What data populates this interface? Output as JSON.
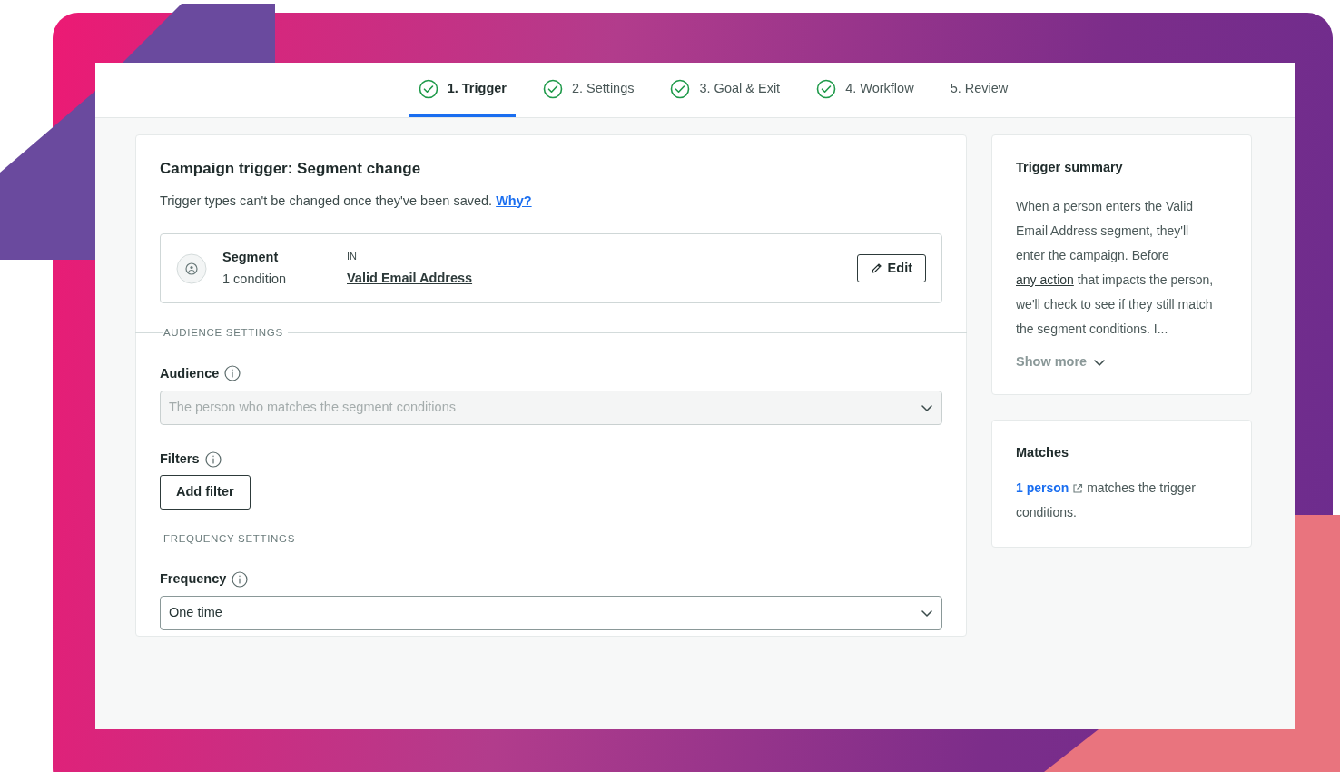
{
  "steps": [
    {
      "label": "1. Trigger",
      "completed": true,
      "selected": true
    },
    {
      "label": "2. Settings",
      "completed": true,
      "selected": false
    },
    {
      "label": "3. Goal & Exit",
      "completed": true,
      "selected": false
    },
    {
      "label": "4. Workflow",
      "completed": true,
      "selected": false
    },
    {
      "label": "5. Review",
      "completed": false,
      "selected": false
    }
  ],
  "trigger": {
    "title": "Campaign trigger: Segment change",
    "note": "Trigger types can't be changed once they've been saved.",
    "why_link": "Why?",
    "segment": {
      "label": "Segment",
      "conditions": "1 condition",
      "relation": "IN",
      "name": "Valid Email Address",
      "edit_button": "Edit"
    }
  },
  "audience_settings": {
    "heading": "AUDIENCE SETTINGS",
    "audience": {
      "label": "Audience",
      "value": "The person who matches the segment conditions",
      "disabled": true
    },
    "filters": {
      "label": "Filters",
      "button": "Add filter"
    }
  },
  "frequency_settings": {
    "heading": "FREQUENCY SETTINGS",
    "frequency": {
      "label": "Frequency",
      "value": "One time",
      "disabled": false
    }
  },
  "summary": {
    "title": "Trigger summary",
    "text_before": "When a person enters the Valid Email Address segment, they'll enter the campaign. Before",
    "link": "any action",
    "text_after": "that impacts the person, we'll check to see if they still match the segment conditions. I...",
    "show_more": "Show more"
  },
  "matches": {
    "title": "Matches",
    "link": "1 person",
    "text": "matches the trigger conditions."
  }
}
